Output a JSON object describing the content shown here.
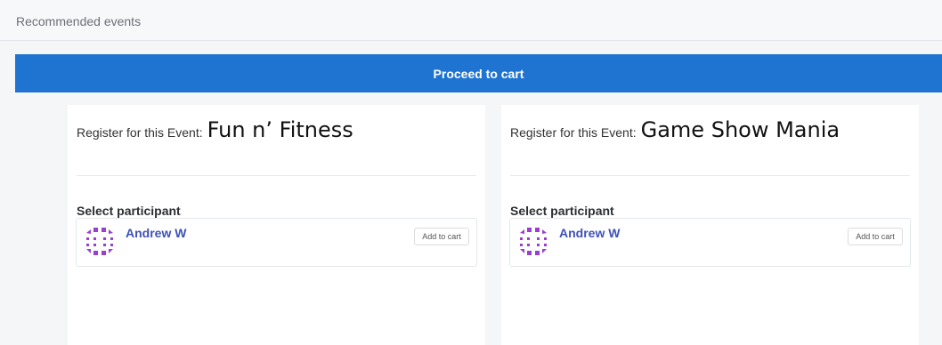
{
  "header": {
    "title": "Recommended events"
  },
  "proceed_button": {
    "label": "Proceed to cart",
    "color": "#1f74d1"
  },
  "events": [
    {
      "register_prefix": "Register for this Event:",
      "event_name": "Fun n’ Fitness",
      "select_label": "Select participant",
      "participant_name": "Andrew W",
      "add_button_label": "Add to cart"
    },
    {
      "register_prefix": "Register for this Event:",
      "event_name": "Game Show Mania",
      "select_label": "Select participant",
      "participant_name": "Andrew W",
      "add_button_label": "Add to cart"
    }
  ],
  "avatar": {
    "icon": "identicon-avatar-icon",
    "color": "#9b3fd1"
  }
}
